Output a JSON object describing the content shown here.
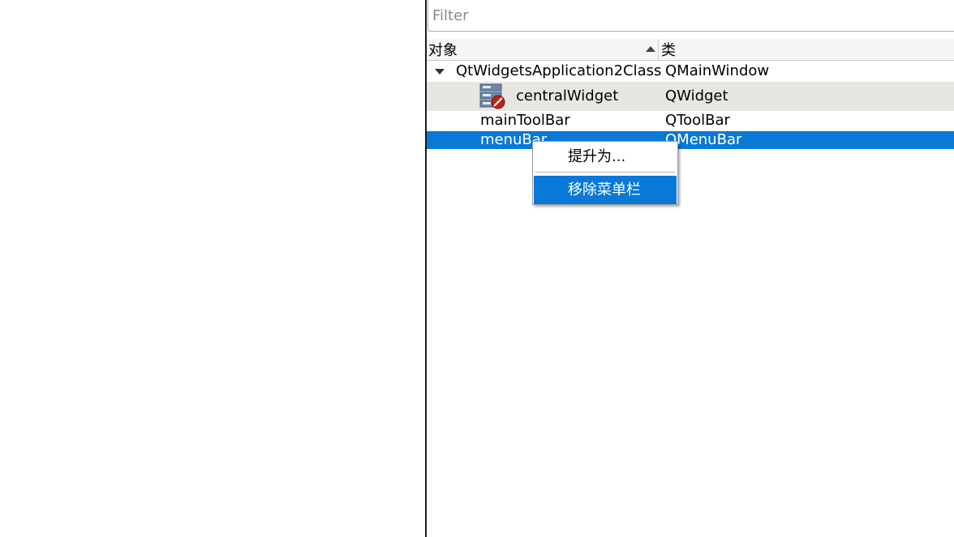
{
  "filter": {
    "placeholder": "Filter",
    "value": ""
  },
  "columns": {
    "object": "对象",
    "class": "类",
    "sorted_column": "object",
    "sort_order": "ascending"
  },
  "tree": {
    "root": {
      "name": "QtWidgetsApplication2Class",
      "class": "QMainWindow",
      "expanded": true
    },
    "children": [
      {
        "name": "centralWidget",
        "class": "QWidget",
        "icon": "layout-broken-widget-icon",
        "state": "hover"
      },
      {
        "name": "mainToolBar",
        "class": "QToolBar"
      },
      {
        "name": "menuBar",
        "class": "QMenuBar",
        "state": "selected"
      }
    ]
  },
  "context_menu": {
    "items": [
      {
        "label": "提升为..."
      },
      {
        "label": "移除菜单栏",
        "state": "highlighted"
      }
    ]
  },
  "colors": {
    "selection": "#0a78d7",
    "hover_row": "#e7e6e3",
    "header_bg": "#f5f5f5",
    "splitter": "#1a1a1a"
  }
}
